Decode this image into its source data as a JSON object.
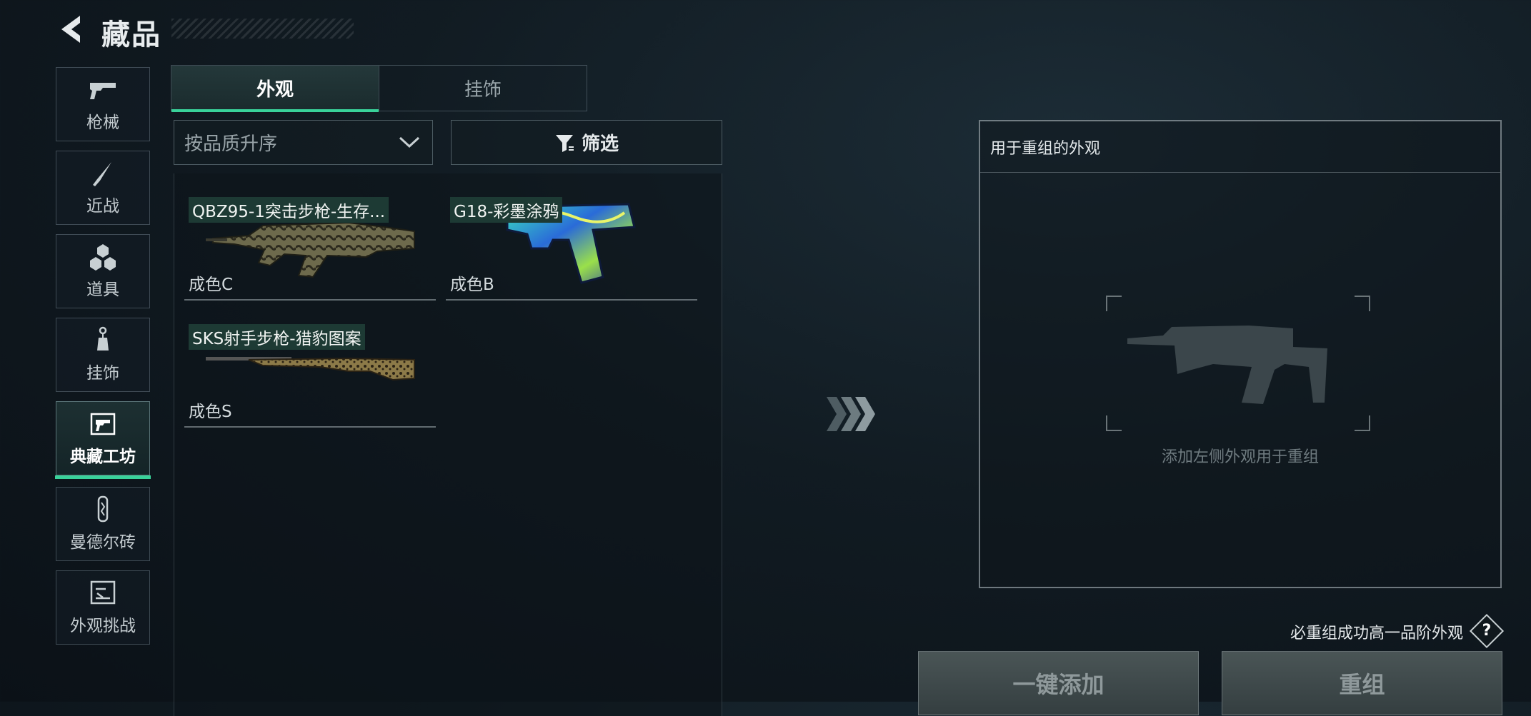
{
  "header": {
    "title": "藏品",
    "back_icon": "back-arrow-icon"
  },
  "sidebar": {
    "items": [
      {
        "label": "枪械",
        "icon": "gun-icon"
      },
      {
        "label": "近战",
        "icon": "knife-icon"
      },
      {
        "label": "道具",
        "icon": "items-icon"
      },
      {
        "label": "挂饰",
        "icon": "charm-icon"
      },
      {
        "label": "典藏工坊",
        "icon": "workshop-icon",
        "active": true
      },
      {
        "label": "曼德尔砖",
        "icon": "brick-icon"
      },
      {
        "label": "外观挑战",
        "icon": "challenge-icon"
      }
    ]
  },
  "tabs": [
    {
      "label": "外观",
      "active": true
    },
    {
      "label": "挂饰",
      "active": false
    }
  ],
  "sort": {
    "value": "按品质升序"
  },
  "filter": {
    "label": "筛选"
  },
  "skins": [
    {
      "name": "QBZ95-1突击步枪-生存...",
      "quality": "成色C"
    },
    {
      "name": "G18-彩墨涂鸦",
      "quality": "成色B"
    },
    {
      "name": "SKS射手步枪-猎豹图案",
      "quality": "成色S"
    }
  ],
  "recombine": {
    "title": "用于重组的外观",
    "hint": "添加左侧外观用于重组",
    "guarantee": "必重组成功高一品阶外观",
    "help": "?",
    "add_all": "一键添加",
    "recombine": "重组"
  },
  "colors": {
    "accent": "#39d29a",
    "name_tag_bg": "#1d3a34"
  }
}
